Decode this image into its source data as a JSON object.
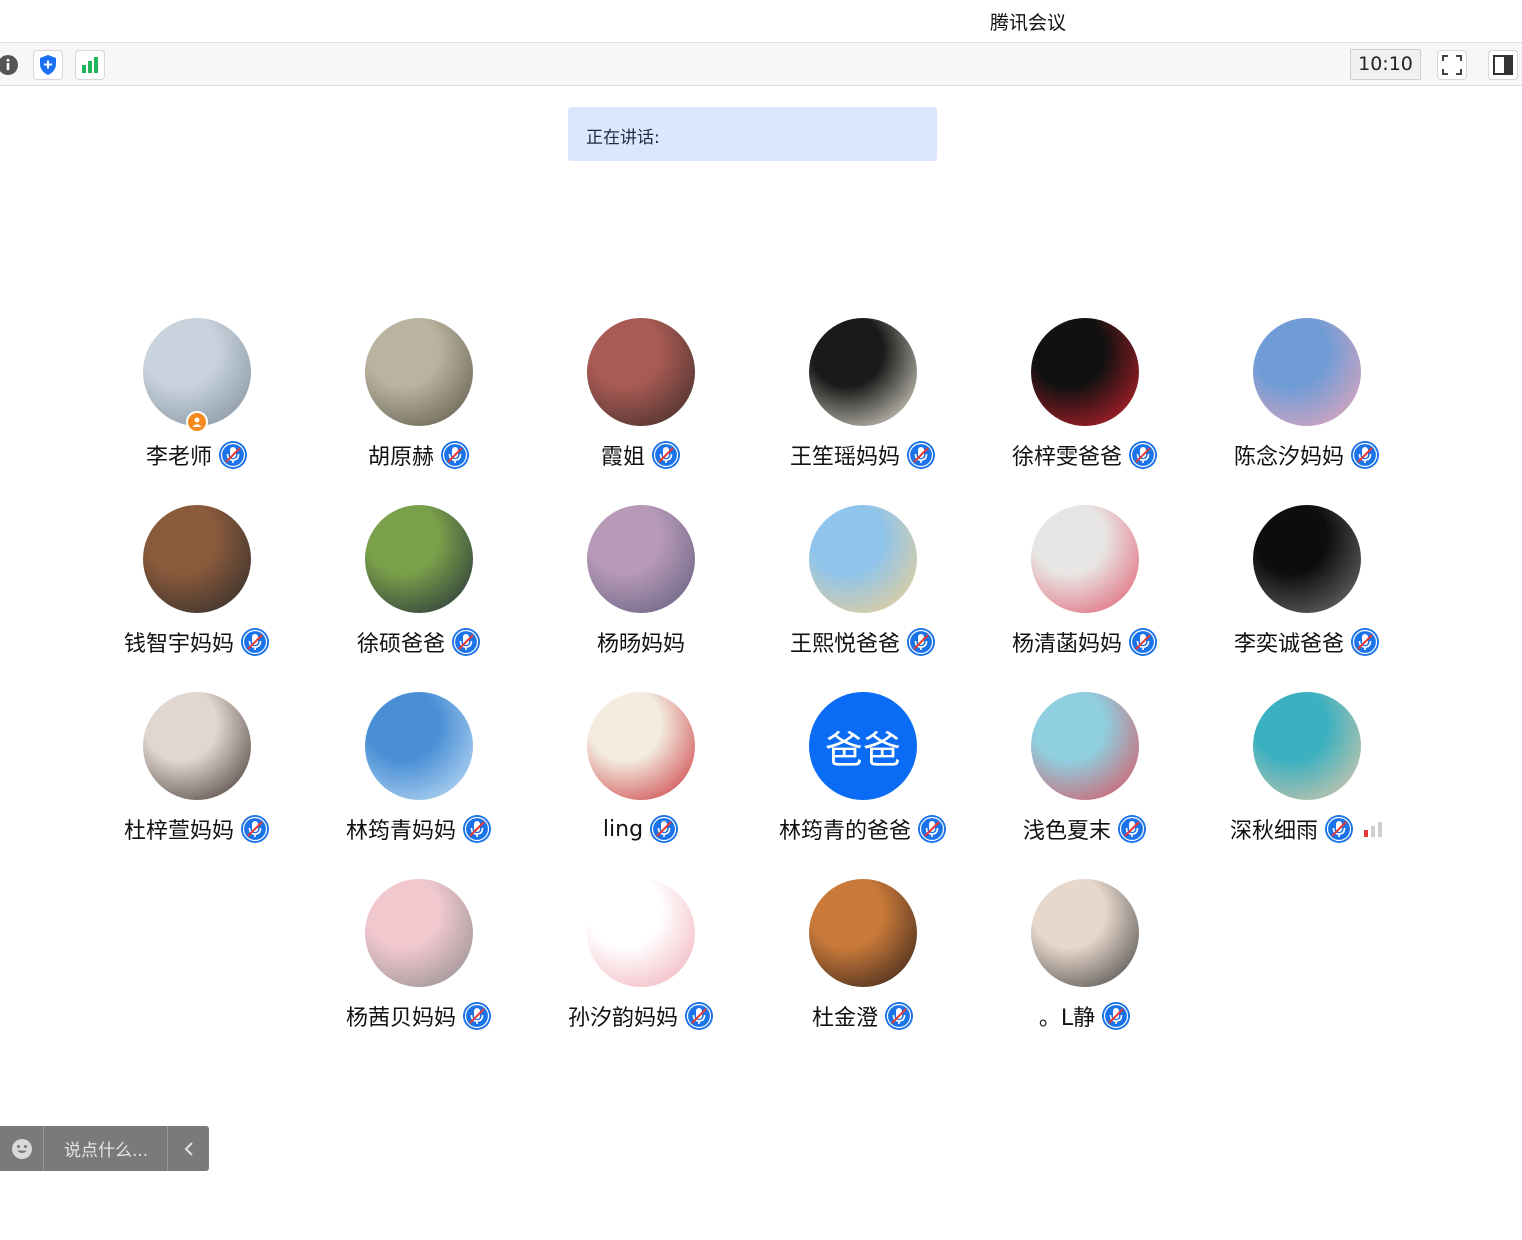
{
  "app": {
    "title": "腾讯会议"
  },
  "toolbar": {
    "time": "10:10",
    "icons": [
      "info-icon",
      "shield-icon",
      "signal-icon",
      "fullscreen-icon",
      "sidebar-icon"
    ]
  },
  "speaking": {
    "label": "正在讲话:"
  },
  "colors": {
    "accent": "#0a6cf5",
    "mic_muted": "#1a73e8",
    "host_badge": "#f68a1e",
    "speaking_bg": "#dbe8fb"
  },
  "participants": [
    {
      "name": "李老师",
      "muted": true,
      "host": true,
      "avatar": "photo",
      "avatar_colors": [
        "#c8d3dd",
        "#7d8b96"
      ]
    },
    {
      "name": "胡原赫",
      "muted": true,
      "avatar": "photo",
      "avatar_colors": [
        "#b9b39f",
        "#5a5446"
      ]
    },
    {
      "name": "霞姐",
      "muted": true,
      "avatar": "photo",
      "avatar_colors": [
        "#a85a54",
        "#3a2a26"
      ]
    },
    {
      "name": "王笙瑶妈妈",
      "muted": true,
      "avatar": "photo",
      "avatar_colors": [
        "#1a1a1a",
        "#f2efe0"
      ]
    },
    {
      "name": "徐梓雯爸爸",
      "muted": true,
      "avatar": "photo",
      "avatar_colors": [
        "#111111",
        "#d4232f"
      ]
    },
    {
      "name": "陈念汐妈妈",
      "muted": true,
      "avatar": "photo",
      "avatar_colors": [
        "#6f9cd6",
        "#f0a7b8"
      ]
    },
    {
      "name": "钱智宇妈妈",
      "muted": true,
      "avatar": "photo",
      "avatar_colors": [
        "#8a5a3c",
        "#2a2a2a"
      ]
    },
    {
      "name": "徐硕爸爸",
      "muted": true,
      "avatar": "photo",
      "avatar_colors": [
        "#7aa04a",
        "#1f2a3a"
      ]
    },
    {
      "name": "杨旸妈妈",
      "muted": false,
      "avatar": "photo",
      "avatar_colors": [
        "#b79ab8",
        "#5e5a7a"
      ]
    },
    {
      "name": "王熙悦爸爸",
      "muted": true,
      "avatar": "photo",
      "avatar_colors": [
        "#8fc4ec",
        "#f5d18a"
      ]
    },
    {
      "name": "杨清菡妈妈",
      "muted": true,
      "avatar": "photo",
      "avatar_colors": [
        "#e8e6e4",
        "#e0566b"
      ]
    },
    {
      "name": "李奕诚爸爸",
      "muted": true,
      "avatar": "photo",
      "avatar_colors": [
        "#0d0d0d",
        "#777777"
      ]
    },
    {
      "name": "杜梓萱妈妈",
      "muted": true,
      "avatar": "photo",
      "avatar_colors": [
        "#e2d6d0",
        "#3a2e2b"
      ]
    },
    {
      "name": "林筠青妈妈",
      "muted": true,
      "avatar": "photo",
      "avatar_colors": [
        "#4a8fd6",
        "#c9e3f5"
      ]
    },
    {
      "name": "ling",
      "muted": true,
      "avatar": "photo",
      "avatar_colors": [
        "#f3ecdf",
        "#c92d35"
      ]
    },
    {
      "name": "林筠青的爸爸",
      "muted": true,
      "avatar": "text",
      "avatar_text": "爸爸",
      "avatar_colors": [
        "#0a6cf5",
        "#0a6cf5"
      ]
    },
    {
      "name": "浅色夏末",
      "muted": true,
      "avatar": "photo",
      "avatar_colors": [
        "#8fcfe0",
        "#e04a55"
      ]
    },
    {
      "name": "深秋细雨",
      "muted": true,
      "weak_signal": true,
      "avatar": "photo",
      "avatar_colors": [
        "#3bb0c0",
        "#e8c9a8"
      ]
    },
    {
      "name": "杨茜贝妈妈",
      "muted": true,
      "avatar": "photo",
      "avatar_colors": [
        "#f2c8cf",
        "#8a8a8a"
      ]
    },
    {
      "name": "孙汐韵妈妈",
      "muted": true,
      "avatar": "photo",
      "avatar_colors": [
        "#ffffff",
        "#f0a9b4"
      ]
    },
    {
      "name": "杜金澄",
      "muted": true,
      "avatar": "photo",
      "avatar_colors": [
        "#c97a3a",
        "#2a1c18"
      ]
    },
    {
      "name": "。L静",
      "muted": true,
      "avatar": "photo",
      "avatar_colors": [
        "#e8d8cc",
        "#3a3a3a"
      ]
    }
  ],
  "chat": {
    "placeholder": "说点什么..."
  }
}
